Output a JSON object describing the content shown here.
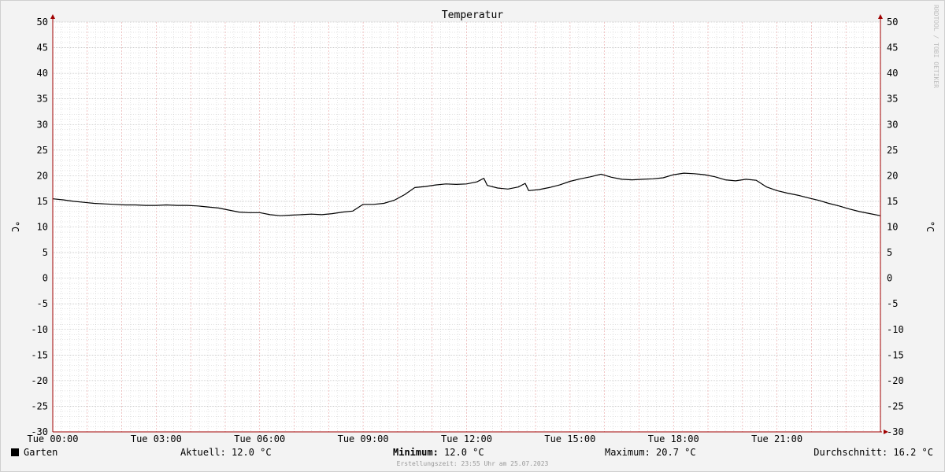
{
  "chart_data": {
    "type": "line",
    "title": "Temperatur",
    "ylabel_left": "°C",
    "ylabel_right": "°C",
    "ylim": [
      -30,
      50
    ],
    "yticks": [
      -30,
      -25,
      -20,
      -15,
      -10,
      -5,
      0,
      5,
      10,
      15,
      20,
      25,
      30,
      35,
      40,
      45,
      50
    ],
    "xlim": [
      0,
      24
    ],
    "xticks": [
      {
        "hour": 0,
        "label": "Tue 00:00"
      },
      {
        "hour": 3,
        "label": "Tue 03:00"
      },
      {
        "hour": 6,
        "label": "Tue 06:00"
      },
      {
        "hour": 9,
        "label": "Tue 09:00"
      },
      {
        "hour": 12,
        "label": "Tue 12:00"
      },
      {
        "hour": 15,
        "label": "Tue 15:00"
      },
      {
        "hour": 18,
        "label": "Tue 18:00"
      },
      {
        "hour": 21,
        "label": "Tue 21:00"
      }
    ],
    "grid": true,
    "watermark": "RRDTOOL / TOBI OETIKER",
    "series": [
      {
        "name": "Garten",
        "color": "#000000",
        "x": [
          0,
          0.3,
          0.6,
          0.9,
          1.2,
          1.5,
          1.8,
          2.1,
          2.4,
          2.7,
          3.0,
          3.3,
          3.6,
          3.9,
          4.2,
          4.5,
          4.8,
          5.1,
          5.4,
          5.7,
          6.0,
          6.3,
          6.6,
          6.9,
          7.2,
          7.5,
          7.8,
          8.1,
          8.4,
          8.7,
          9.0,
          9.3,
          9.6,
          9.9,
          10.2,
          10.5,
          10.8,
          11.1,
          11.4,
          11.7,
          12.0,
          12.3,
          12.5,
          12.6,
          12.9,
          13.2,
          13.5,
          13.7,
          13.8,
          14.1,
          14.4,
          14.7,
          15.0,
          15.3,
          15.6,
          15.9,
          16.2,
          16.5,
          16.8,
          17.1,
          17.4,
          17.7,
          18.0,
          18.3,
          18.6,
          18.9,
          19.2,
          19.5,
          19.8,
          20.1,
          20.4,
          20.7,
          21.0,
          21.3,
          21.6,
          21.9,
          22.2,
          22.5,
          22.8,
          23.1,
          23.4,
          23.7,
          24.0
        ],
        "y": [
          15.5,
          15.3,
          15.0,
          14.8,
          14.6,
          14.5,
          14.4,
          14.3,
          14.3,
          14.2,
          14.2,
          14.3,
          14.2,
          14.2,
          14.1,
          13.9,
          13.7,
          13.3,
          12.9,
          12.8,
          12.8,
          12.4,
          12.2,
          12.3,
          12.4,
          12.5,
          12.4,
          12.6,
          12.9,
          13.1,
          14.4,
          14.4,
          14.6,
          15.2,
          16.3,
          17.7,
          17.9,
          18.2,
          18.4,
          18.3,
          18.4,
          18.8,
          19.5,
          18.1,
          17.6,
          17.4,
          17.8,
          18.5,
          17.1,
          17.3,
          17.7,
          18.2,
          18.9,
          19.4,
          19.8,
          20.3,
          19.7,
          19.3,
          19.2,
          19.3,
          19.4,
          19.6,
          20.2,
          20.5,
          20.4,
          20.2,
          19.8,
          19.2,
          19.0,
          19.3,
          19.1,
          17.8,
          17.1,
          16.6,
          16.2,
          15.7,
          15.2,
          14.6,
          14.1,
          13.5,
          13.0,
          12.6,
          12.2
        ]
      }
    ]
  },
  "legend": {
    "series_name": "Garten",
    "aktuell": "Aktuell: 12.0 °C",
    "minimum_label": "Minimum:",
    "minimum_value": " 12.0 °C",
    "maximum": "Maximum: 20.7 °C",
    "durchschnitt": "Durchschnitt: 16.2 °C",
    "footer": "Erstellungszeit: 23:55 Uhr am 25.07.2023"
  },
  "colors": {
    "background": "#f3f3f3",
    "canvas": "#ffffff",
    "grid_minor": "#c8c8c8",
    "grid_major": "#e8a0a0",
    "axis": "#a00000",
    "line": "#000000",
    "text": "#000000",
    "watermark": "#bdbdbd",
    "footer_text": "#999999"
  }
}
